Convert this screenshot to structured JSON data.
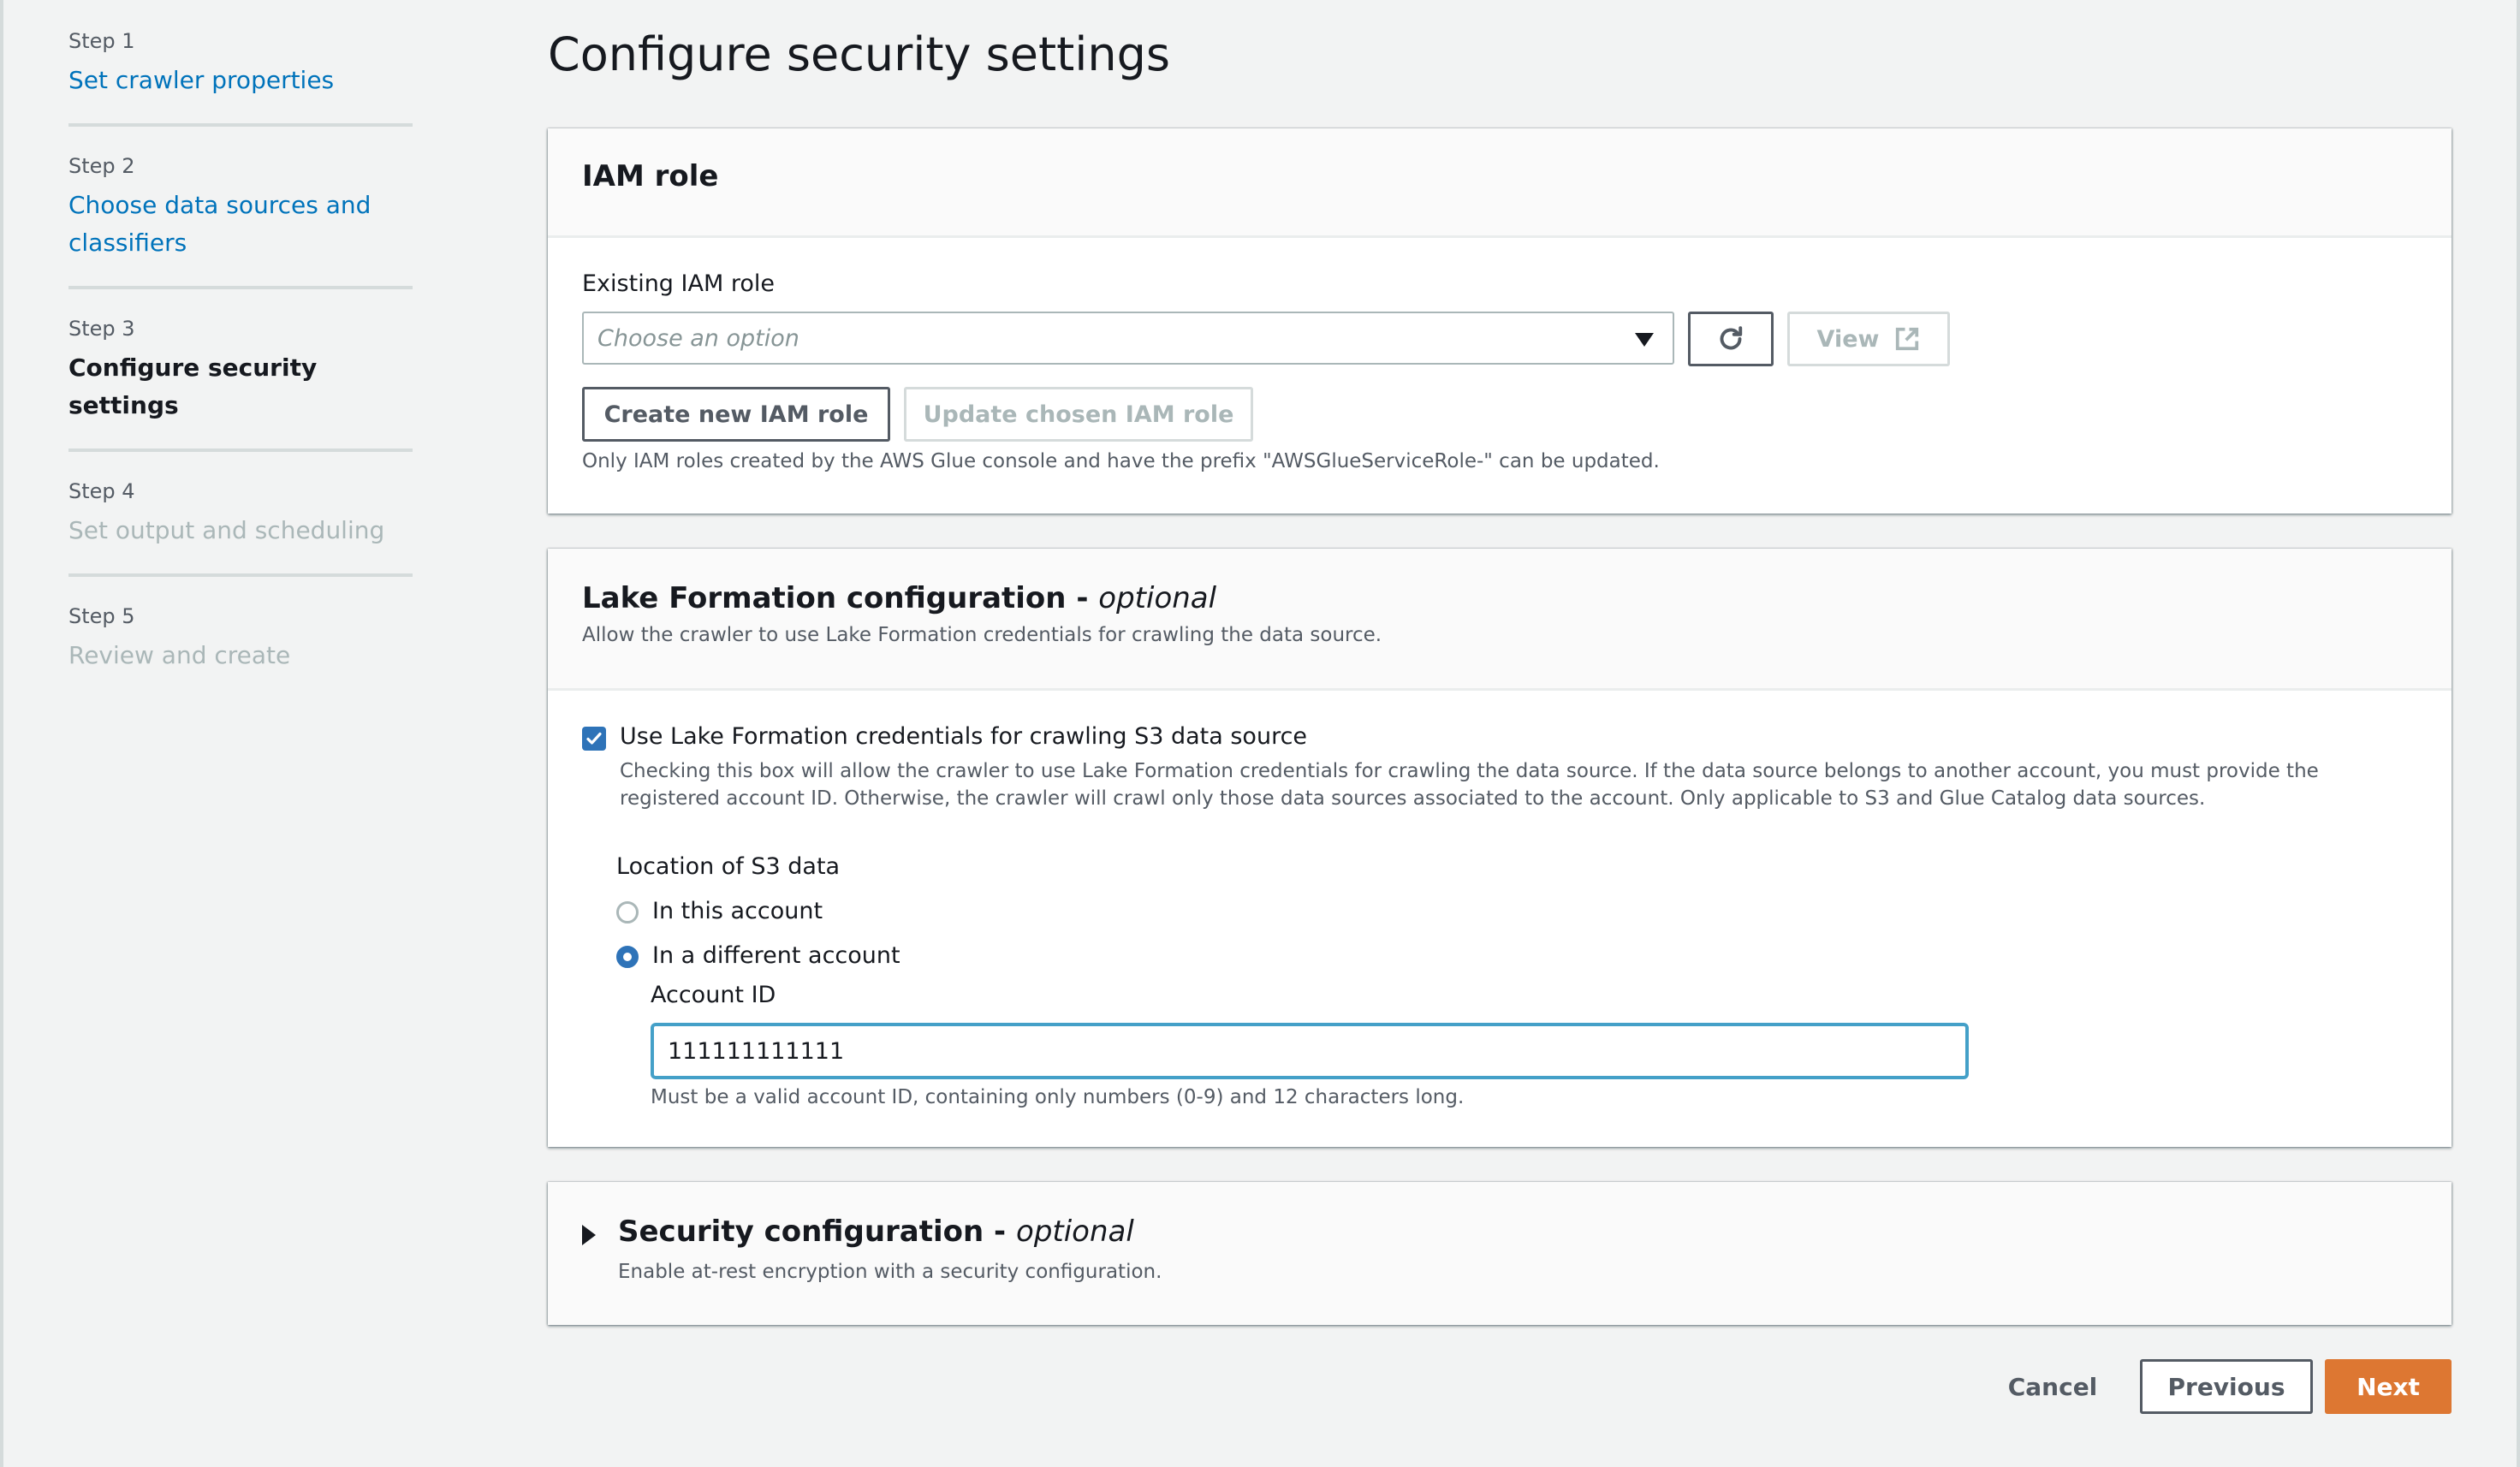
{
  "sidebar": {
    "steps": [
      {
        "number": "Step 1",
        "title": "Set crawler properties",
        "state": "link"
      },
      {
        "number": "Step 2",
        "title": "Choose data sources and classifiers",
        "state": "link"
      },
      {
        "number": "Step 3",
        "title": "Configure security settings",
        "state": "current"
      },
      {
        "number": "Step 4",
        "title": "Set output and scheduling",
        "state": "disabled"
      },
      {
        "number": "Step 5",
        "title": "Review and create",
        "state": "disabled"
      }
    ]
  },
  "page": {
    "title": "Configure security settings"
  },
  "iam_role": {
    "title": "IAM role",
    "field_label": "Existing IAM role",
    "select_placeholder": "Choose an option",
    "refresh_icon": "refresh-icon",
    "view_label": "View",
    "view_icon": "external-link-icon",
    "create_label": "Create new IAM role",
    "update_label": "Update chosen IAM role",
    "hint": "Only IAM roles created by the AWS Glue console and have the prefix \"AWSGlueServiceRole-\" can be updated."
  },
  "lake_formation": {
    "title": "Lake Formation configuration - ",
    "title_optional": "optional",
    "description": "Allow the crawler to use Lake Formation credentials for crawling the data source.",
    "checkbox_label": "Use Lake Formation credentials for crawling S3 data source",
    "checkbox_checked": true,
    "checkbox_description": "Checking this box will allow the crawler to use Lake Formation credentials for crawling the data source. If the data source belongs to another account, you must provide the registered account ID. Otherwise, the crawler will crawl only those data sources associated to the account. Only applicable to S3 and Glue Catalog data sources.",
    "location_label": "Location of S3 data",
    "location_options": [
      {
        "label": "In this account",
        "selected": false
      },
      {
        "label": "In a different account",
        "selected": true
      }
    ],
    "account_id_label": "Account ID",
    "account_id_value": "111111111111",
    "account_id_hint": "Must be a valid account ID, containing only numbers (0-9) and 12 characters long."
  },
  "security_config": {
    "title": "Security configuration - ",
    "title_optional": "optional",
    "description": "Enable at-rest encryption with a security configuration.",
    "expanded": false
  },
  "footer": {
    "cancel_label": "Cancel",
    "previous_label": "Previous",
    "next_label": "Next"
  },
  "colors": {
    "link": "#0073bb",
    "primary_button": "#dd7732",
    "checkbox": "#2e73b8",
    "focus_border": "#44a0c8",
    "page_bg": "#f2f3f3"
  }
}
